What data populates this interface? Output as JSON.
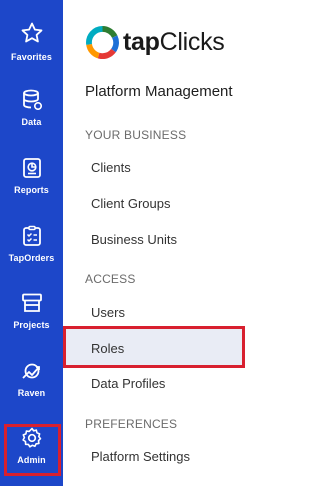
{
  "rail": {
    "items": [
      {
        "label": "Favorites",
        "icon": "star-icon"
      },
      {
        "label": "Data",
        "icon": "database-icon"
      },
      {
        "label": "Reports",
        "icon": "report-icon"
      },
      {
        "label": "TapOrders",
        "icon": "checklist-icon"
      },
      {
        "label": "Projects",
        "icon": "store-icon"
      },
      {
        "label": "Raven",
        "icon": "raven-chart-icon"
      },
      {
        "label": "Admin",
        "icon": "gear-icon"
      }
    ]
  },
  "logo": {
    "bold": "tap",
    "light": "Clicks"
  },
  "panel": {
    "title": "Platform Management",
    "sections": [
      {
        "heading": "YOUR BUSINESS",
        "items": [
          "Clients",
          "Client Groups",
          "Business Units"
        ]
      },
      {
        "heading": "ACCESS",
        "items": [
          "Users",
          "Roles",
          "Data Profiles"
        ]
      },
      {
        "heading": "PREFERENCES",
        "items": [
          "Platform Settings"
        ]
      }
    ]
  },
  "colors": {
    "rail": "#1d47c9",
    "highlight_border": "#d8202f",
    "selected_bg": "#e9ecf5"
  }
}
